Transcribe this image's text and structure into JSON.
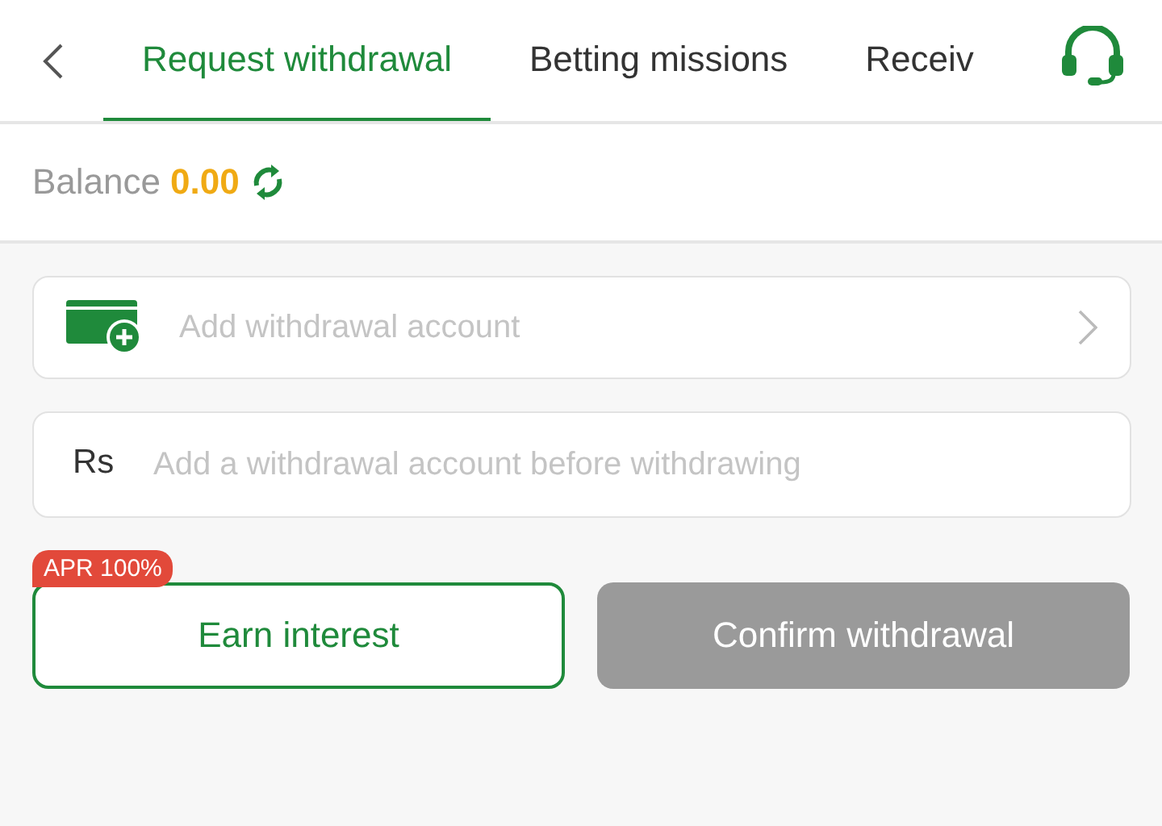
{
  "tabs": [
    {
      "label": "Request withdrawal",
      "selected": true
    },
    {
      "label": "Betting missions",
      "selected": false
    },
    {
      "label": "Receiv",
      "selected": false
    }
  ],
  "balance": {
    "label": "Balance",
    "amount": "0.00"
  },
  "account_row": {
    "placeholder": "Add withdrawal account"
  },
  "amount_field": {
    "currency": "Rs",
    "placeholder": "Add a withdrawal account before withdrawing"
  },
  "earn_button": {
    "label": "Earn interest",
    "badge": "APR 100%"
  },
  "confirm_button": {
    "label": "Confirm withdrawal",
    "disabled": true
  }
}
